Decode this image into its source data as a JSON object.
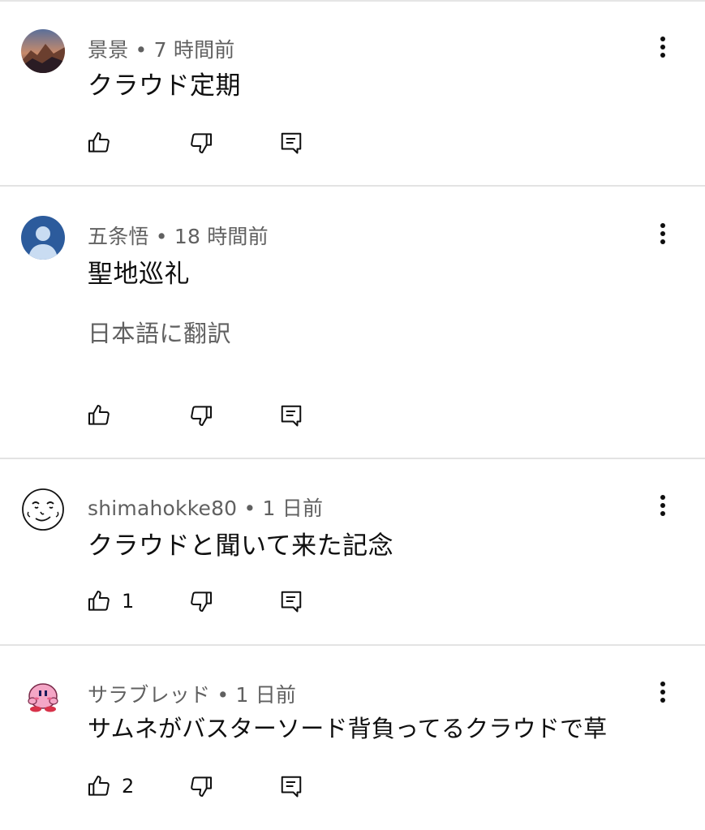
{
  "comments": [
    {
      "author": "景景",
      "separator": " • ",
      "time": "7 時間前",
      "text": "クラウド定期",
      "translate": null,
      "likes": null,
      "avatar": "mountain-avatar-icon"
    },
    {
      "author": "五条悟",
      "separator": " • ",
      "time": "18 時間前",
      "text": "聖地巡礼",
      "translate": "日本語に翻訳",
      "likes": null,
      "avatar": "default-person-avatar-icon"
    },
    {
      "author": "shimahokke80",
      "separator": " • ",
      "time": "1 日前",
      "text": "クラウドと聞いて来た記念",
      "translate": null,
      "likes": "1",
      "avatar": "sketch-face-avatar-icon"
    },
    {
      "author": "サラブレッド",
      "separator": " • ",
      "time": "1 日前",
      "text": "サムネがバスターソード背負ってるクラウドで草",
      "translate": null,
      "likes": "2",
      "avatar": "pink-character-avatar-icon"
    }
  ],
  "colors": {
    "meta_text": "#606060",
    "body_text": "#0f0f0f",
    "divider": "#e3e3e3",
    "avatar_blue": "#2c5b9c",
    "avatar_pink": "#f4a6c6"
  }
}
